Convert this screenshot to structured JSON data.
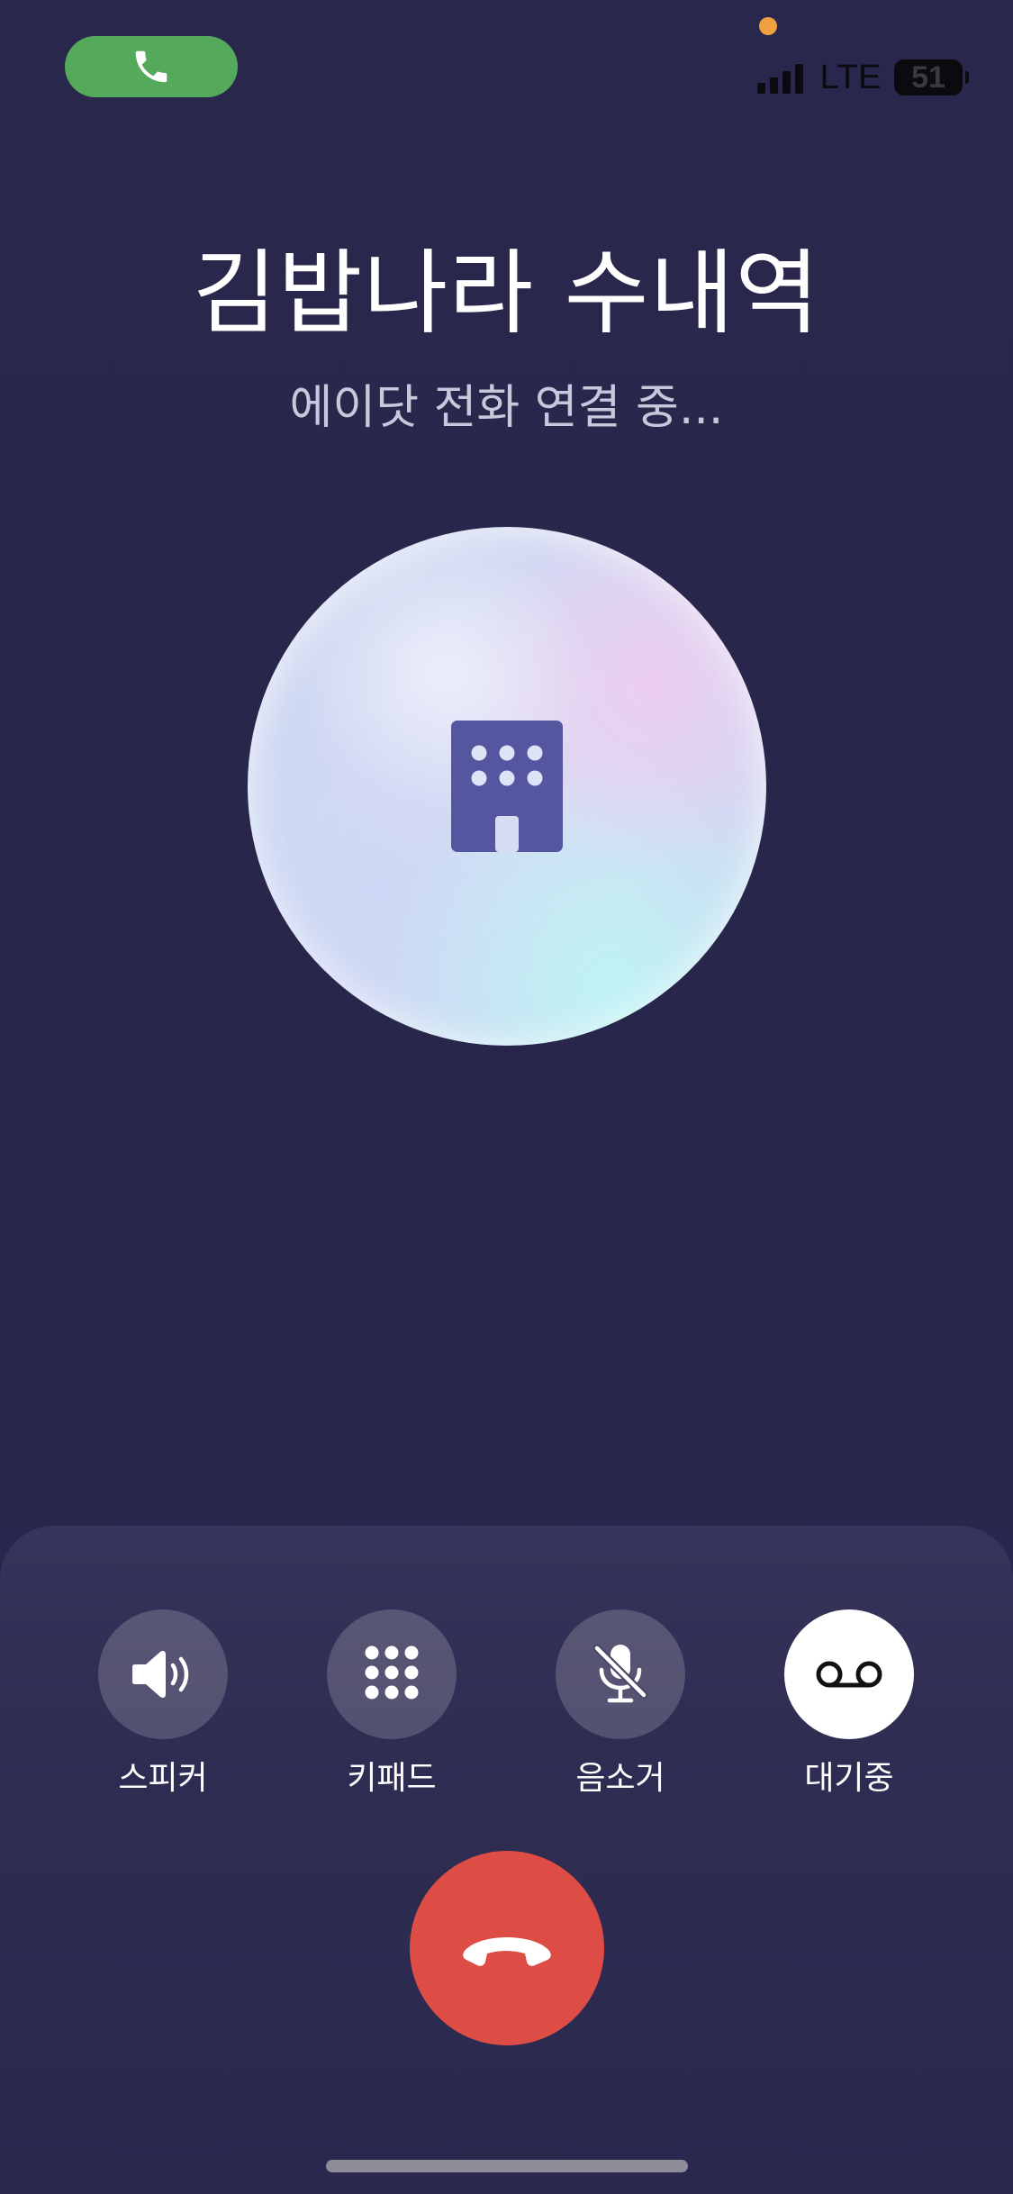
{
  "status_bar": {
    "call_pill_icon": "phone-icon",
    "network": "LTE",
    "battery_level": "51",
    "call_pill_color": "#55a95a",
    "privacy_dot_color": "#f0a040"
  },
  "call": {
    "title": "김밥나라 수내역",
    "status": "에이닷 전화 연결 중...",
    "avatar_icon": "building-icon"
  },
  "controls": [
    {
      "label": "스피커",
      "icon": "speaker-icon",
      "active": false
    },
    {
      "label": "키패드",
      "icon": "keypad-icon",
      "active": false
    },
    {
      "label": "음소거",
      "icon": "mic-muted-icon",
      "active": false
    },
    {
      "label": "대기중",
      "icon": "voicemail-icon",
      "active": true
    }
  ],
  "end_call": {
    "icon": "hang-up-icon",
    "color": "#de4d45"
  }
}
